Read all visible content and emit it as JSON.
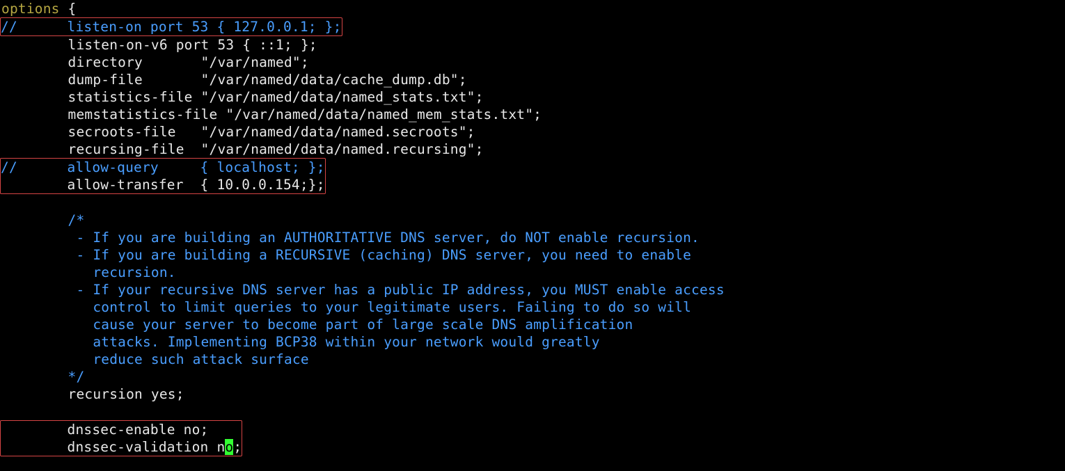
{
  "lines": {
    "l01a": "options",
    "l01b": " {",
    "l02": "//      listen-on port 53 { 127.0.0.1; };",
    "l03": "        listen-on-v6 port 53 { ::1; };",
    "l04": "        directory       \"/var/named\";",
    "l05": "        dump-file       \"/var/named/data/cache_dump.db\";",
    "l06": "        statistics-file \"/var/named/data/named_stats.txt\";",
    "l07": "        memstatistics-file \"/var/named/data/named_mem_stats.txt\";",
    "l08": "        secroots-file   \"/var/named/data/named.secroots\";",
    "l09": "        recursing-file  \"/var/named/data/named.recursing\";",
    "l10": "//      allow-query     { localhost; };",
    "l11": "        allow-transfer  { 10.0.0.154;};",
    "l12": "",
    "l13": "        /*",
    "l14": "         - If you are building an AUTHORITATIVE DNS server, do NOT enable recursion.",
    "l15": "         - If you are building a RECURSIVE (caching) DNS server, you need to enable",
    "l16": "           recursion.",
    "l17": "         - If your recursive DNS server has a public IP address, you MUST enable access",
    "l18": "           control to limit queries to your legitimate users. Failing to do so will",
    "l19": "           cause your server to become part of large scale DNS amplification",
    "l20": "           attacks. Implementing BCP38 within your network would greatly",
    "l21": "           reduce such attack surface",
    "l22": "        */",
    "l23": "        recursion yes;",
    "l24": "",
    "l25": "        dnssec-enable no;",
    "l26a": "        dnssec-validation n",
    "l26b": "o",
    "l26c": ";"
  }
}
